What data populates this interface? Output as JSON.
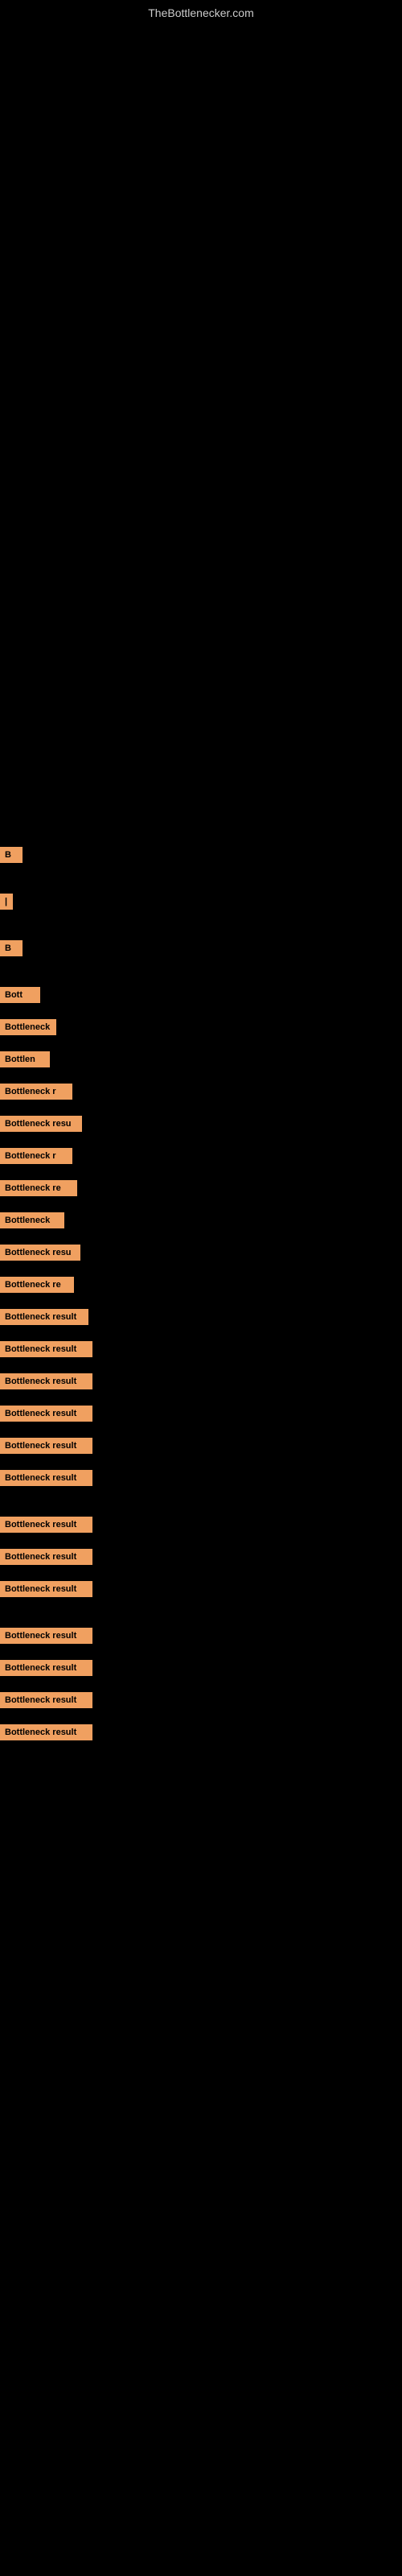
{
  "header": {
    "site_title": "TheBottlenecker.com"
  },
  "items": [
    {
      "id": 1,
      "label": "B",
      "class": "item-1"
    },
    {
      "id": 2,
      "label": "|",
      "class": "item-2"
    },
    {
      "id": 3,
      "label": "B",
      "class": "item-3"
    },
    {
      "id": 4,
      "label": "Bott",
      "class": "item-4"
    },
    {
      "id": 5,
      "label": "Bottleneck",
      "class": "item-5"
    },
    {
      "id": 6,
      "label": "Bottlen",
      "class": "item-6"
    },
    {
      "id": 7,
      "label": "Bottleneck r",
      "class": "item-7"
    },
    {
      "id": 8,
      "label": "Bottleneck resu",
      "class": "item-8"
    },
    {
      "id": 9,
      "label": "Bottleneck r",
      "class": "item-9"
    },
    {
      "id": 10,
      "label": "Bottleneck re",
      "class": "item-10"
    },
    {
      "id": 11,
      "label": "Bottleneck",
      "class": "item-11"
    },
    {
      "id": 12,
      "label": "Bottleneck resu",
      "class": "item-12"
    },
    {
      "id": 13,
      "label": "Bottleneck re",
      "class": "item-13"
    },
    {
      "id": 14,
      "label": "Bottleneck result",
      "class": "item-14"
    },
    {
      "id": 15,
      "label": "Bottleneck result",
      "class": "item-15"
    },
    {
      "id": 16,
      "label": "Bottleneck result",
      "class": "item-16"
    },
    {
      "id": 17,
      "label": "Bottleneck result",
      "class": "item-17"
    },
    {
      "id": 18,
      "label": "Bottleneck result",
      "class": "item-18"
    },
    {
      "id": 19,
      "label": "Bottleneck result",
      "class": "item-19"
    },
    {
      "id": 20,
      "label": "Bottleneck result",
      "class": "item-20"
    },
    {
      "id": 21,
      "label": "Bottleneck result",
      "class": "item-21"
    },
    {
      "id": 22,
      "label": "Bottleneck result",
      "class": "item-22"
    },
    {
      "id": 23,
      "label": "Bottleneck result",
      "class": "item-23"
    },
    {
      "id": 24,
      "label": "Bottleneck result",
      "class": "item-24"
    },
    {
      "id": 25,
      "label": "Bottleneck result",
      "class": "item-25"
    },
    {
      "id": 26,
      "label": "Bottleneck result",
      "class": "item-26"
    }
  ]
}
